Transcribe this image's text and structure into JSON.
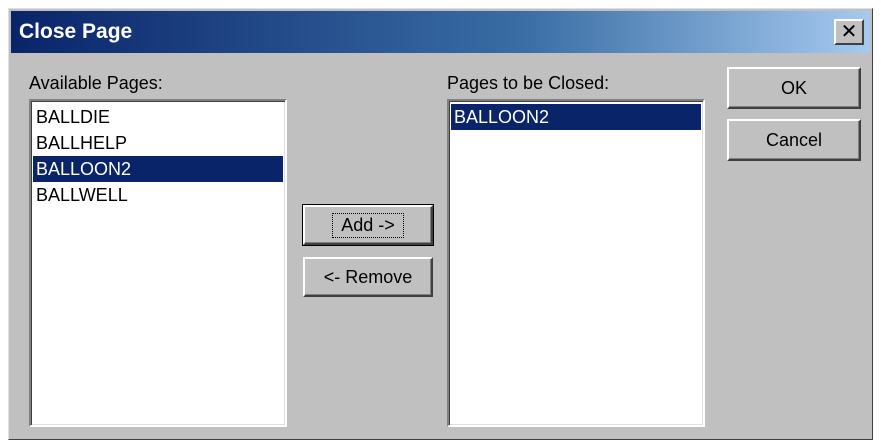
{
  "dialog": {
    "title": "Close Page",
    "close_glyph": "✕"
  },
  "available": {
    "label": "Available Pages:",
    "items": [
      "BALLDIE",
      "BALLHELP",
      "BALLOON2",
      "BALLWELL"
    ],
    "selected_index": 2
  },
  "to_close": {
    "label": "Pages to be Closed:",
    "items": [
      "BALLOON2"
    ],
    "selected_index": 0
  },
  "buttons": {
    "add": "Add ->",
    "remove": "<- Remove",
    "ok": "OK",
    "cancel": "Cancel"
  },
  "colors": {
    "title_bar": "#0a246a",
    "selection": "#0a246a",
    "dialog_face": "#c0c0c0"
  }
}
